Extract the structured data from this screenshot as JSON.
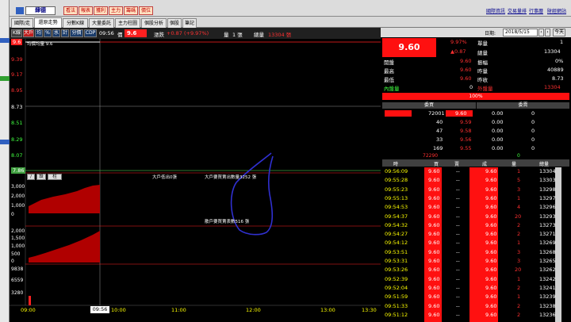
{
  "title_bar": {
    "stock_name": "肆德",
    "buttons": [
      "看法",
      "報表",
      "獲利",
      "主力",
      "籌碼",
      "價位"
    ]
  },
  "news_links": [
    "國際資訊",
    "交易量排",
    "行事曆",
    "財經網站"
  ],
  "tabs": [
    "國際/走勢",
    "還原走勢",
    "分數K線",
    "大量委託",
    "主力柱圖",
    "個股分析",
    "個股",
    "筆記"
  ],
  "chart_toolbar": {
    "buttons": [
      "K線",
      "大戶",
      "均",
      "%",
      "水",
      "計",
      "分價",
      "CDP"
    ],
    "time": "09:56",
    "price_label": "價",
    "price": "9.6",
    "change_label": "漲跌",
    "change": "+0.87 (+9.97%)",
    "volume_label": "量",
    "volume": "1 張",
    "total_label": "總量",
    "total": "13304 張"
  },
  "price_axis": [
    "9.6",
    "9.39",
    "9.17",
    "8.95",
    "8.73",
    "8.51",
    "8.29",
    "8.07",
    "7.86"
  ],
  "avg_label": "均價均量 9.6",
  "annotation_big_sell": "大戶低出0張",
  "annotation_big_buy": "大戶要買賣出數量3252 張",
  "annotation_retail": "散戶要買賣表數516 張",
  "sub1_axis": [
    "3,000",
    "2,000",
    "1,000",
    "0"
  ],
  "sub2_axis": [
    "2,000",
    "1,500",
    "1,000",
    "500",
    "0"
  ],
  "sub3_axis": [
    "9838",
    "6559",
    "3280"
  ],
  "mini_buttons": [
    "/",
    "設",
    "柱"
  ],
  "time_axis": [
    "09:00",
    "10:00",
    "11:00",
    "12:00",
    "13:00",
    "13:30"
  ],
  "cursor_time": "09:56",
  "datebar": {
    "label": "日期:",
    "date": "2018/5/15",
    "today_btn": "今天"
  },
  "quote": {
    "price": "9.60",
    "change_pct": "9.97%",
    "change": "▲0.87",
    "single_label": "單量",
    "single": "1",
    "total_label": "總量",
    "total": "13304",
    "rows": [
      {
        "l1": "開盤",
        "v1": "9.60",
        "l2": "振幅",
        "v2": "0%"
      },
      {
        "l1": "最高",
        "v1": "9.60",
        "l2": "昨量",
        "v2": "40889"
      },
      {
        "l1": "最低",
        "v1": "9.60",
        "l2": "昨收",
        "v2": "8.73"
      }
    ],
    "inner_label": "內盤量",
    "inner": "0",
    "outer_label": "外盤量",
    "outer": "13304",
    "ratio": "100%"
  },
  "orderbook": {
    "bid_header": "委買",
    "ask_header": "委賣",
    "rows": [
      {
        "bq": "72001",
        "bp": "9.60",
        "ap": "0.00",
        "aq": "0"
      },
      {
        "bq": "40",
        "bp": "9.59",
        "ap": "0.00",
        "aq": "0"
      },
      {
        "bq": "47",
        "bp": "9.58",
        "ap": "0.00",
        "aq": "0"
      },
      {
        "bq": "33",
        "bp": "9.56",
        "ap": "0.00",
        "aq": "0"
      },
      {
        "bq": "169",
        "bp": "9.55",
        "ap": "0.00",
        "aq": "0"
      }
    ],
    "sum_bid": "72290",
    "sum_ask": "0"
  },
  "ticks": {
    "headers": [
      "時",
      "買",
      "賣",
      "成",
      "量",
      "總量"
    ],
    "rows": [
      [
        "09:56:09",
        "9.60",
        "--",
        "9.60",
        "1",
        "13304"
      ],
      [
        "09:55:28",
        "9.60",
        "--",
        "9.60",
        "5",
        "13303"
      ],
      [
        "09:55:23",
        "9.60",
        "--",
        "9.60",
        "3",
        "13298"
      ],
      [
        "09:55:13",
        "9.60",
        "--",
        "9.60",
        "1",
        "13297"
      ],
      [
        "09:54:53",
        "9.60",
        "--",
        "9.60",
        "4",
        "13296"
      ],
      [
        "09:54:37",
        "9.60",
        "--",
        "9.60",
        "20",
        "13293"
      ],
      [
        "09:54:32",
        "9.60",
        "--",
        "9.60",
        "2",
        "13273"
      ],
      [
        "09:54:27",
        "9.60",
        "--",
        "9.60",
        "2",
        "13271"
      ],
      [
        "09:54:12",
        "9.60",
        "--",
        "9.60",
        "1",
        "13269"
      ],
      [
        "09:53:51",
        "9.60",
        "--",
        "9.60",
        "3",
        "13268"
      ],
      [
        "09:53:31",
        "9.60",
        "--",
        "9.60",
        "3",
        "13265"
      ],
      [
        "09:53:26",
        "9.60",
        "--",
        "9.60",
        "20",
        "13262"
      ],
      [
        "09:52:39",
        "9.60",
        "--",
        "9.60",
        "1",
        "13242"
      ],
      [
        "09:52:04",
        "9.60",
        "--",
        "9.60",
        "2",
        "13241"
      ],
      [
        "09:51:59",
        "9.60",
        "--",
        "9.60",
        "1",
        "13239"
      ],
      [
        "09:51:33",
        "9.60",
        "--",
        "9.60",
        "2",
        "13238"
      ],
      [
        "09:51:12",
        "9.60",
        "--",
        "9.60",
        "2",
        "13236"
      ]
    ]
  }
}
